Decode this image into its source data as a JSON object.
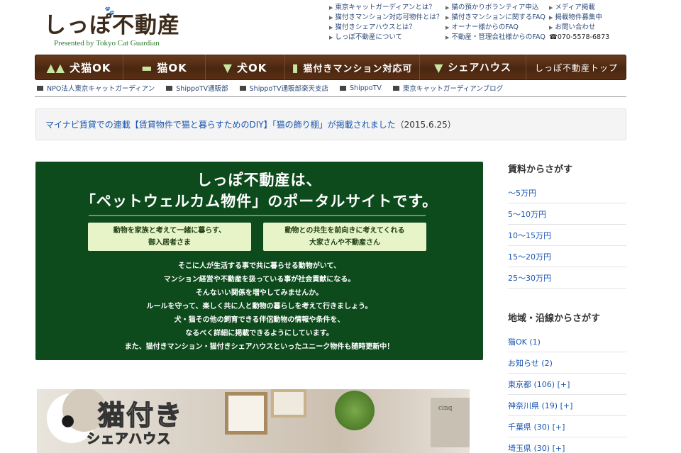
{
  "logo": {
    "main": "しっぽ不動産",
    "paw": "🐾",
    "sub": "Presented by Tokyo Cat Guardian"
  },
  "toplinks": {
    "col1": [
      "東京キャットガーディアンとは？",
      "猫付きマンション対応可物件とは？",
      "猫付きシェアハウスとは？",
      "しっぽ不動産について"
    ],
    "col2": [
      "猫の預かりボランティア申込",
      "猫付きマンションに関するFAQ",
      "オーナー様からのFAQ",
      "不動産・管理会社様からのFAQ"
    ],
    "col3": [
      "メディア掲載",
      "掲載物件募集中",
      "お問い合わせ"
    ],
    "phone": "☎070-5578-6873"
  },
  "nav": [
    {
      "label": "犬猫OK",
      "icon": "dog-cat-icon",
      "glyph": "▲▲"
    },
    {
      "label": "猫OK",
      "icon": "cat-icon",
      "glyph": "▬"
    },
    {
      "label": "犬OK",
      "icon": "dog-icon",
      "glyph": "▼"
    },
    {
      "label": "猫付きマンション対応可",
      "icon": "cat-sitting-icon",
      "glyph": "▮"
    },
    {
      "label": "シェアハウス",
      "icon": "cat-share-icon",
      "glyph": "▼"
    },
    {
      "label": "しっぽ不動産トップ",
      "icon": "",
      "glyph": ""
    }
  ],
  "subnav": [
    "NPO法人東京キャットガーディアン",
    "ShippoTV通販部",
    "ShippoTV通販部楽天支店",
    "ShippoTV",
    "東京キャットガーディアンブログ"
  ],
  "news": {
    "link": "マイナビ賃貸での連載【賃貸物件で猫と暮らすためのDIY】「猫の飾り棚」が掲載されました",
    "date": "（2015.6.25）"
  },
  "hero": {
    "line1": "しっぽ不動産は、",
    "line2": "「ペットウェルカム物件」のポータルサイトです。",
    "box1": [
      "動物を家族と考えて一緒に暮らす、",
      "御入居者さま"
    ],
    "box2": [
      "動物との共生を前向きに考えてくれる",
      "大家さんや不動産さん"
    ],
    "body": [
      "そこに人が生活する事で共に暮らせる動物がいて、",
      "マンション経営や不動産を扱っている事が社会貢献になる。",
      "そんないい関係を増やしてみませんか。",
      "ルールを守って、楽しく共に人と動物の暮らしを考えて行きましょう。",
      "犬・猫その他の飼育できる伴侶動物の情報や条件を、",
      "なるべく詳細に掲載できるようにしています。",
      "また、猫付きマンション・猫付きシェアハウスといったユニーク物件も随時更新中！"
    ]
  },
  "banner2": {
    "title": "猫付き",
    "sub": "シェアハウス",
    "box_label": "cinq"
  },
  "sidebar": {
    "rent_heading": "賃料からさがす",
    "rent": [
      "〜5万円",
      "5〜10万円",
      "10〜15万円",
      "15〜20万円",
      "25〜30万円"
    ],
    "area_heading": "地域・沿線からさがす",
    "area": [
      "猫OK (1)",
      "お知らせ (2)",
      "東京都 (106) [+]",
      "神奈川県 (19) [+]",
      "千葉県 (30) [+]",
      "埼玉県 (30) [+]"
    ]
  }
}
